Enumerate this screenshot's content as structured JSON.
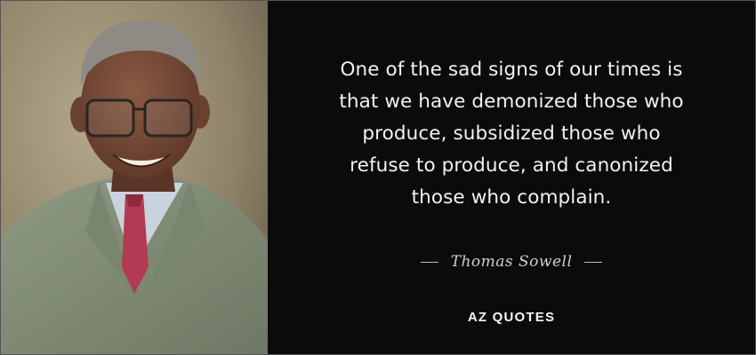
{
  "quote": {
    "text": "One of the sad signs of our times is\nthat we have demonized those who\nproduce, subsidized those who\nrefuse to produce, and canonized\nthose who complain."
  },
  "author": {
    "name": "Thomas Sowell"
  },
  "brand": {
    "name": "AZ QUOTES"
  },
  "colors": {
    "background": "#0b0b0b",
    "quote_text": "#f2f2f2",
    "author_text": "#cfcfcf",
    "suit": "#7f8a74",
    "tie": "#b23a52"
  },
  "image": {
    "subject": "author-portrait"
  }
}
